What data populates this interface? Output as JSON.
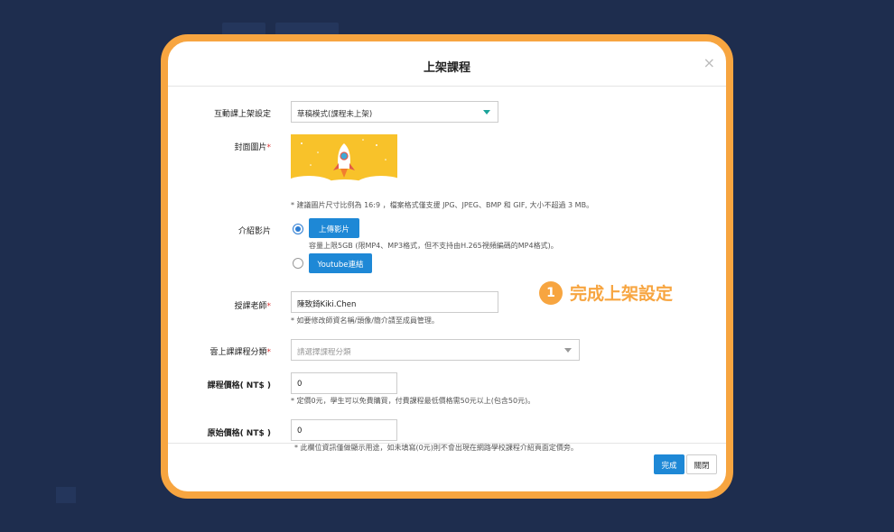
{
  "modal": {
    "title": "上架課程",
    "close_symbol": "×"
  },
  "form": {
    "interactive_setting": {
      "label": "互動課上架設定",
      "value": "草稿模式(課程未上架)"
    },
    "cover_image": {
      "label": "封面圖片",
      "required_mark": "*",
      "hint": "* 建議圖片尺寸比例為 16:9 ，檔案格式僅支援 JPG、JPEG、BMP 和 GIF, 大小不超過 3 MB。"
    },
    "intro_video": {
      "label": "介紹影片",
      "upload_button": "上傳影片",
      "upload_hint": "容量上限5GB (限MP4、MP3格式，但不支持由H.265視頻編碼的MP4格式)。",
      "youtube_button": "Youtube連結"
    },
    "teacher": {
      "label": "授課老師",
      "required_mark": "*",
      "value": "陳致錡Kiki.Chen",
      "hint": "* 如要修改師資名稱/頭像/簡介請至成員管理。"
    },
    "category": {
      "label": "雲上課課程分類",
      "required_mark": "*",
      "placeholder": "請選擇課程分類"
    },
    "price": {
      "label": "課程價格( NT$ )",
      "value": "0",
      "hint": "* 定價0元，學生可以免費購買，付費課程最低價格需50元以上(包含50元)。"
    },
    "original_price": {
      "label": "原始價格( NT$ )",
      "value": "0",
      "hint": "* 此欄位資訊僅做顯示用途，如未填寫(0元)則不會出現在網路學校課程介紹頁面定價旁。"
    }
  },
  "callout": {
    "number": "1",
    "text": "完成上架設定"
  },
  "footer": {
    "done_label": "完成",
    "close_label": "關閉"
  },
  "colors": {
    "frame": "#f7a540",
    "primary_button": "#1e88d6",
    "overlay": "#1e2d4e",
    "cover_background": "#f8c22a"
  }
}
